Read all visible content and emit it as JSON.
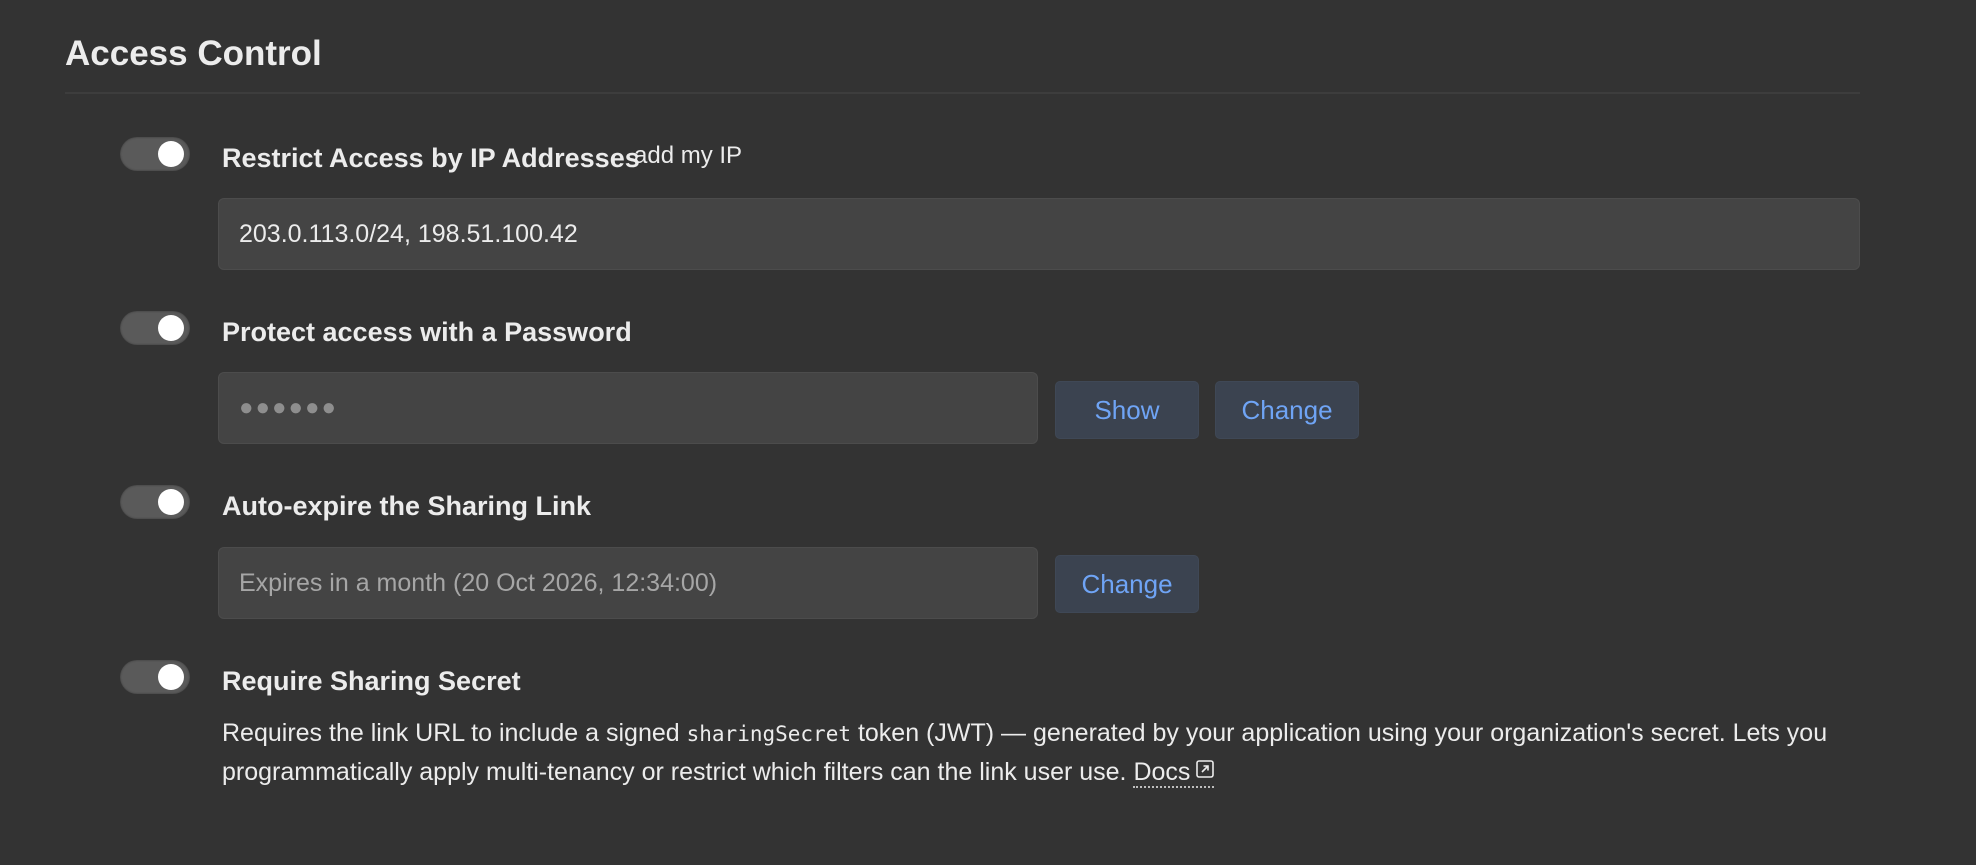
{
  "section": {
    "title": "Access Control"
  },
  "ip_restriction": {
    "label": "Restrict Access by IP Addresses",
    "add_my_ip_label": "add my IP",
    "value": "203.0.113.0/24, 198.51.100.42",
    "enabled": true
  },
  "password": {
    "label": "Protect access with a Password",
    "masked_value": "●●●●●●",
    "show_label": "Show",
    "change_label": "Change",
    "enabled": true
  },
  "auto_expire": {
    "label": "Auto-expire the Sharing Link",
    "value": "Expires in a month (20 Oct 2026, 12:34:00)",
    "change_label": "Change",
    "enabled": true
  },
  "sharing_secret": {
    "label": "Require Sharing Secret",
    "desc_before": "Requires the link URL to include a signed ",
    "desc_code": "sharingSecret",
    "desc_after": " token (JWT) — generated by your application using your organization's secret. Lets you programmatically apply multi-tenancy or restrict which filters can the link user use. ",
    "docs_label": "Docs",
    "enabled": true
  },
  "icons": {
    "external_link": "external-link-icon"
  },
  "colors": {
    "background": "#333333",
    "accent": "#6fa4f5",
    "toggle_track": "#5a5a5a",
    "field_bg": "#444444",
    "button_bg": "#3b4350"
  }
}
